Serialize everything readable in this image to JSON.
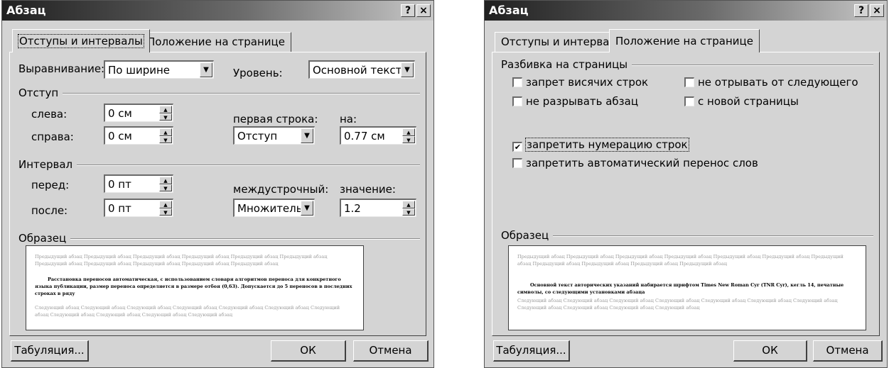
{
  "left_dialog": {
    "title": "Абзац",
    "help_button": "?",
    "close_button": "×",
    "tabs": [
      "Отступы и интервалы",
      "Положение на странице"
    ],
    "alignment_label": "Выравнивание:",
    "alignment_value": "По ширине",
    "level_label": "Уровень:",
    "level_value": "Основной текст",
    "indent_group": "Отступ",
    "left_label": "слева:",
    "left_value": "0 см",
    "right_label": "справа:",
    "right_value": "0 см",
    "first_line_label": "первая строка:",
    "first_line_value": "Отступ",
    "by_label": "на:",
    "by_value": "0.77 см",
    "spacing_group": "Интервал",
    "before_label": "перед:",
    "before_value": "0 пт",
    "after_label": "после:",
    "after_value": "0 пт",
    "line_spacing_label": "междустрочный:",
    "line_spacing_value": "Множитель",
    "at_label": "значение:",
    "at_value": "1.2",
    "sample_group": "Образец",
    "preview_prev": "Предыдущий абзац Предыдущий абзац Предыдущий абзац Предыдущий абзац Предыдущий абзац Предыдущий абзац Предыдущий абзац Предыдущий абзац Предыдущий абзац Предыдущий абзац Предыдущий абзац",
    "preview_main": "Расстановка переносов автоматическая, с использованием словаря алгоритмов переноса для конкретного языка публикации, размер переноса определяется в размере отбоя (0,63). Допускается до 5 переносов в последних строках в ряду",
    "preview_next": "Следующий абзац Следующий абзац Следующий абзац Следующий абзац Следующий абзац Следующий абзац Следующий абзац Следующий абзац Следующий абзац Следующий абзац Следующий абзац",
    "tabs_button": "Табуляция...",
    "ok_button": "ОК",
    "cancel_button": "Отмена"
  },
  "right_dialog": {
    "title": "Абзац",
    "help_button": "?",
    "close_button": "×",
    "tabs": [
      "Отступы и интервалы",
      "Положение на странице"
    ],
    "pagination_group": "Разбивка на страницы",
    "widow_control": {
      "label": "запрет висячих строк",
      "checked": false
    },
    "keep_with_next": {
      "label": "не отрывать от следующего",
      "checked": false
    },
    "keep_lines_together": {
      "label": "не разрывать абзац",
      "checked": false
    },
    "page_break_before": {
      "label": "с новой страницы",
      "checked": false
    },
    "suppress_line_numbers": {
      "label": "запретить нумерацию строк",
      "checked": true
    },
    "dont_hyphenate": {
      "label": "запретить автоматический перенос слов",
      "checked": false
    },
    "check_mark": "✔",
    "sample_group": "Образец",
    "preview_prev": "Предыдущий абзац Предыдущий абзац Предыдущий абзац Предыдущий абзац Предыдущий абзац Предыдущий абзац Предыдущий абзац Предыдущий абзац Предыдущий абзац Предыдущий абзац Предыдущий абзац",
    "preview_main": "Основной текст авторических указаний набирается шрифтом Times New Roman Cyr (TNR Cyr), кегль 14, печатные символы, со следующими установками абзаца",
    "preview_next": "Следующий абзац Следующий абзац Следующий абзац Следующий абзац Следующий абзац Следующий абзац Следующий абзац Следующий абзац Следующий абзац Следующий абзац Следующий абзац",
    "tabs_button": "Табуляция...",
    "ok_button": "ОК",
    "cancel_button": "Отмена"
  }
}
